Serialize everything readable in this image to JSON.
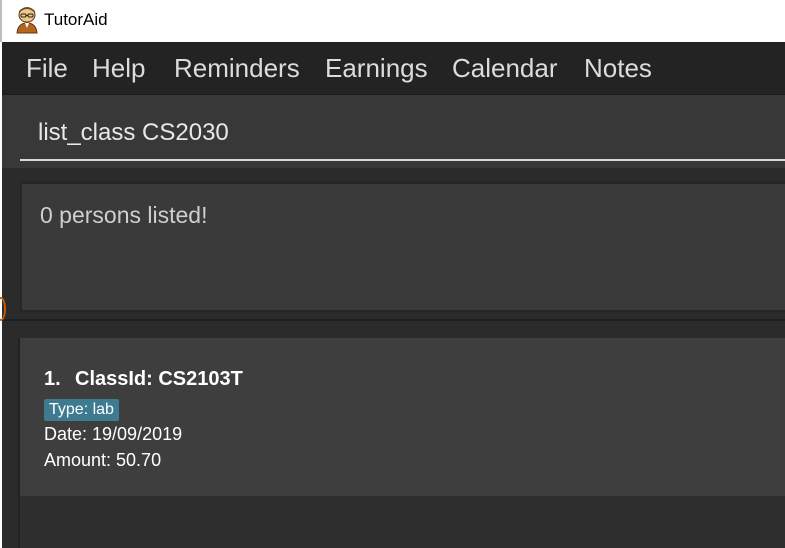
{
  "window": {
    "title": "TutorAid",
    "icon": "tutor-avatar-icon"
  },
  "menubar": {
    "items": [
      {
        "label": "File"
      },
      {
        "label": "Help"
      },
      {
        "label": "Reminders"
      },
      {
        "label": "Earnings"
      },
      {
        "label": "Calendar"
      },
      {
        "label": "Notes"
      }
    ]
  },
  "command": {
    "value": "list_class CS2030"
  },
  "result": {
    "message": "0 persons listed!"
  },
  "earnings_list": {
    "items": [
      {
        "index": "1.",
        "title": "ClassId: CS2103T",
        "tag": "Type: lab",
        "date": "Date: 19/09/2019",
        "amount": "Amount: 50.70"
      }
    ]
  },
  "colors": {
    "background": "#2b2b2b",
    "menubar": "#232323",
    "card": "#3e3e3e",
    "tag": "#3e7b91",
    "text": "#ffffff"
  }
}
